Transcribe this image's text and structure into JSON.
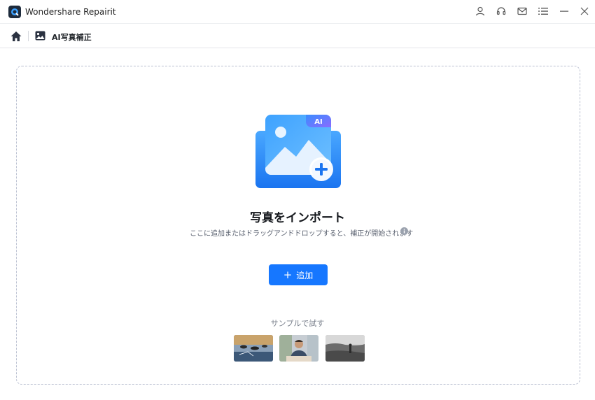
{
  "window": {
    "title": "Wondershare Repairit",
    "icons": [
      "user-icon",
      "headset-icon",
      "mail-icon",
      "menu-icon",
      "minimize-icon",
      "close-icon"
    ]
  },
  "nav": {
    "current_label": "AI写真補正"
  },
  "main": {
    "title": "写真をインポート",
    "subtitle": "ここに追加またはドラッグアンドドロップすると、補正が開始されます",
    "add_button_label": "追加",
    "sample_label": "サンプルで試す",
    "samples": [
      "sample-birds-photo",
      "sample-portrait-photo",
      "sample-bw-field-photo"
    ],
    "ai_badge": "AI"
  },
  "colors": {
    "accent": "#1677ff",
    "dashed_border": "#b9bfd0"
  }
}
